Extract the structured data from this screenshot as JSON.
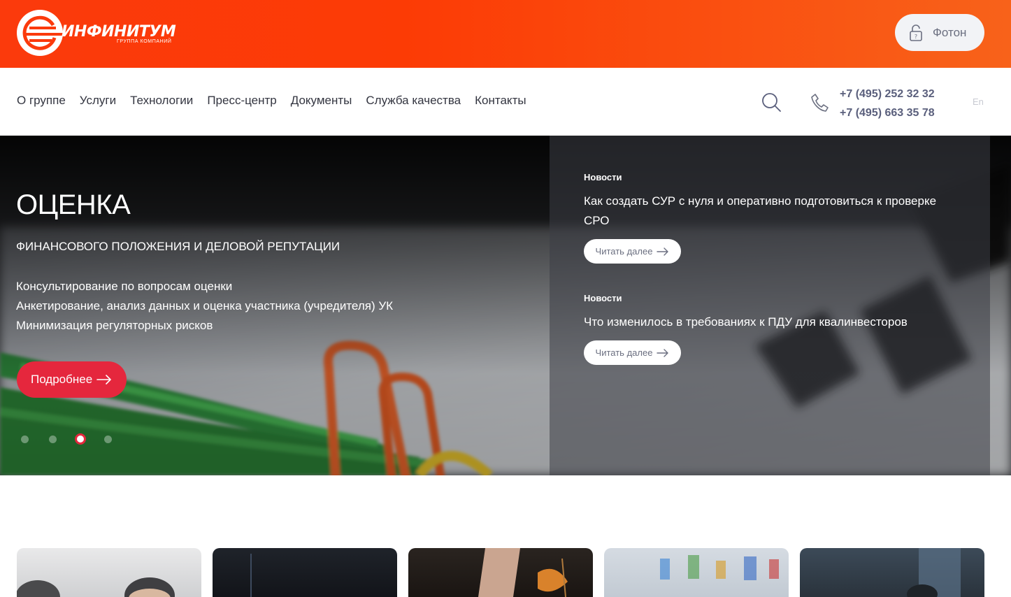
{
  "header": {
    "logo_text": "ИНФИНИТУМ",
    "logo_subtext": "ГРУППА КОМПАНИЙ",
    "account_button_label": "Фотон"
  },
  "nav": {
    "items": [
      "О группе",
      "Услуги",
      "Технологии",
      "Пресс-центр",
      "Документы",
      "Служба качества",
      "Контакты"
    ],
    "phones": [
      "+7 (495) 252 32 32",
      "+7 (495) 663 35 78"
    ],
    "language": "En"
  },
  "hero": {
    "title": "ОЦЕНКА",
    "subtitle": "ФИНАНСОВОГО ПОЛОЖЕНИЯ И ДЕЛОВОЙ РЕПУТАЦИИ",
    "points": [
      "Консультирование по вопросам оценки",
      "Анкетирование, анализ данных и оценка участника (учредителя) УК",
      "Минимизация регуляторных рисков"
    ],
    "more_button_label": "Подробнее",
    "slides_count": 4,
    "active_slide": 3
  },
  "news": [
    {
      "tag": "Новости",
      "headline": "Как создать СУР с нуля и оперативно подготовиться к проверке СРО",
      "button_label": "Читать далее"
    },
    {
      "tag": "Новости",
      "headline": "Что изменилось в требованиях к ПДУ для квалинвесторов",
      "button_label": "Читать далее"
    }
  ],
  "colors": {
    "brand_orange": "#fb3a0c",
    "accent_red": "#e5273d",
    "phone_text": "#5a5f7c"
  }
}
